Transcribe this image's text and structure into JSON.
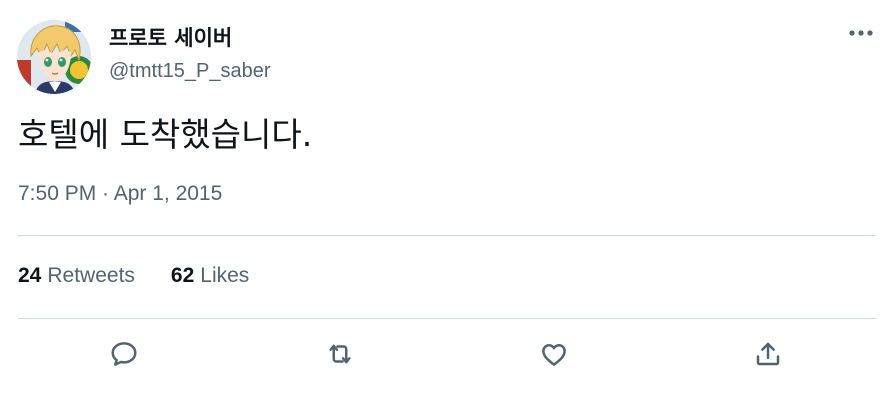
{
  "author": {
    "display_name": "프로토 세이버",
    "handle": "@tmtt15_P_saber",
    "avatar_icon": "anime-avatar-icon"
  },
  "tweet": {
    "text": "호텔에 도착했습니다.",
    "timestamp": "7:50 PM · Apr 1, 2015"
  },
  "stats": {
    "retweets_count": "24",
    "retweets_label": "Retweets",
    "likes_count": "62",
    "likes_label": "Likes"
  },
  "actions": [
    {
      "name": "reply",
      "icon": "speech-bubble-icon"
    },
    {
      "name": "retweet",
      "icon": "retweet-arrows-icon"
    },
    {
      "name": "like",
      "icon": "heart-icon"
    },
    {
      "name": "share",
      "icon": "share-upload-icon"
    }
  ],
  "colors": {
    "text_primary": "#0f1419",
    "text_secondary": "#536471",
    "divider": "#cfd9de",
    "background": "#ffffff"
  }
}
